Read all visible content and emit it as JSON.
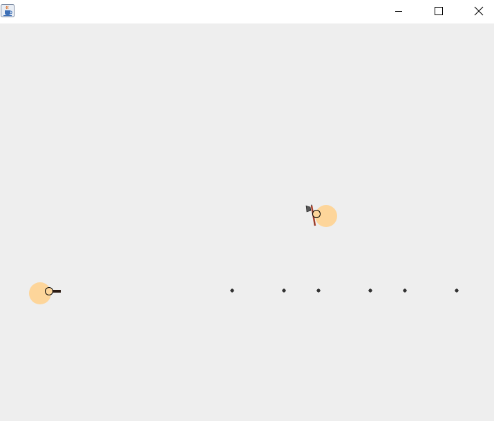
{
  "window": {
    "title": "",
    "icon": "java-cup-icon",
    "controls": [
      "minimize-icon",
      "maximize-icon",
      "close-icon"
    ]
  },
  "game": {
    "colors": {
      "background": "#eeeeee",
      "player_glow": "#fdd59a",
      "head_fill": "#fdd59a",
      "outline": "#000000",
      "bullet": "#333333",
      "gun": "#2b1b14",
      "axe_handle": "#c8462b",
      "axe_head": "#555555"
    },
    "entities": [
      {
        "type": "player",
        "weapon": "gun"
      },
      {
        "type": "enemy",
        "weapon": "axe"
      }
    ],
    "bullet_count": 6
  }
}
